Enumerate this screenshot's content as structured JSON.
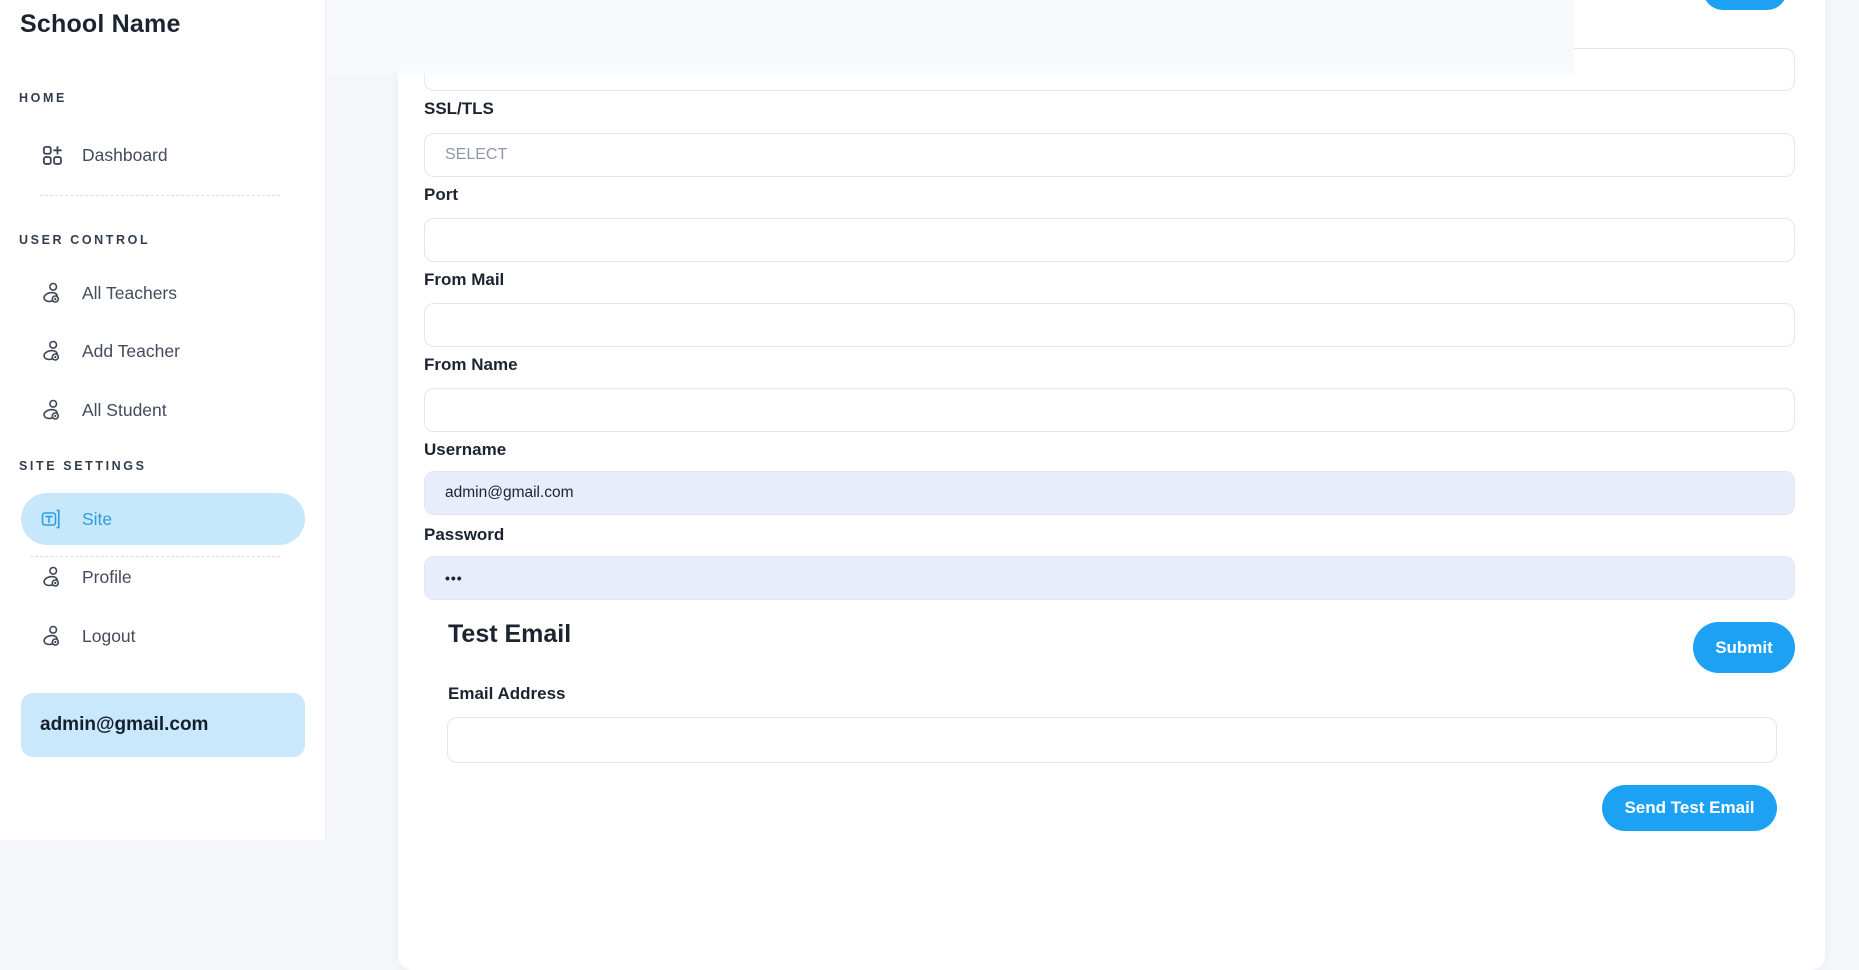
{
  "sidebar": {
    "title": "School Name",
    "sections": [
      {
        "label": "HOME",
        "items": [
          {
            "label": "Dashboard",
            "icon": "dashboard-grid-plus-icon",
            "active": false
          }
        ]
      },
      {
        "label": "USER CONTROL",
        "items": [
          {
            "label": "All Teachers",
            "icon": "person-icon",
            "active": false
          },
          {
            "label": "Add Teacher",
            "icon": "person-icon",
            "active": false
          },
          {
            "label": "All Student",
            "icon": "person-icon",
            "active": false
          }
        ]
      },
      {
        "label": "SITE SETTINGS",
        "items": [
          {
            "label": "Site",
            "icon": "text-input-cursor-icon",
            "active": true
          },
          {
            "label": "Profile",
            "icon": "person-icon",
            "active": false
          },
          {
            "label": "Logout",
            "icon": "person-icon",
            "active": false
          }
        ]
      }
    ],
    "user_email": "admin@gmail.com"
  },
  "smtp_form": {
    "top_input_value": "",
    "fields": {
      "ssl": {
        "label": "SSL/TLS",
        "placeholder": "SELECT",
        "value": ""
      },
      "port": {
        "label": "Port",
        "value": ""
      },
      "from_mail": {
        "label": "From Mail",
        "value": ""
      },
      "from_name": {
        "label": "From Name",
        "value": ""
      },
      "username": {
        "label": "Username",
        "value": "admin@gmail.com"
      },
      "password": {
        "label": "Password",
        "value": "•••"
      }
    }
  },
  "test_email": {
    "heading": "Test Email",
    "submit_label": "Submit",
    "email_label": "Email Address",
    "email_value": "",
    "send_button_label": "Send Test Email"
  },
  "colors": {
    "accent_blue": "#1da1f3",
    "active_item_bg": "#c7e7fb",
    "active_item_text": "#2b9fe0",
    "autofill_bg": "#e8eef9",
    "page_bg": "#f4f6fa",
    "card_bg": "#ffffff"
  }
}
